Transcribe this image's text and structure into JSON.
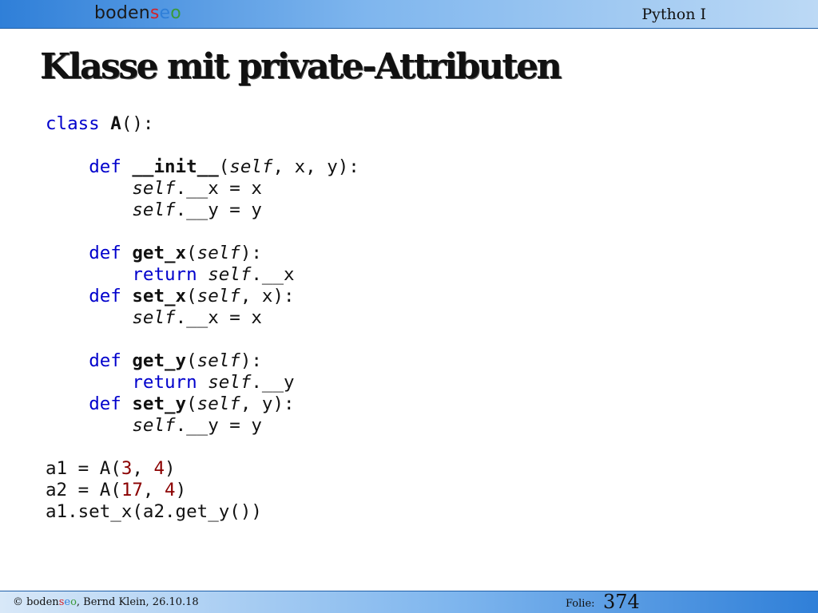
{
  "header": {
    "brand": {
      "part1": "boden",
      "part2": "s",
      "part3": "e",
      "part4": "o"
    },
    "course": "Python I"
  },
  "title": "Klasse mit private-Attributen",
  "code": {
    "tokens": {
      "class": "class",
      "A": "A",
      "paren_colon": "():",
      "def": "def",
      "init": "__init__",
      "self": "self",
      "return": "return",
      "get_x": "get_x",
      "set_x": "set_x",
      "get_y": "get_y",
      "set_y": "set_y",
      "open": "(",
      "close_colon": "):",
      "args_xy": ", x, y):",
      "arg_x": ", x):",
      "arg_y": ", y):",
      "attr_x_assign": ".__x = x",
      "attr_y_assign": ".__y = y",
      "attr_x": ".__x",
      "attr_y": ".__y"
    },
    "tail": {
      "a1_prefix": "a1 = A(",
      "a1_n1": "3",
      "comma": ", ",
      "a1_n2": "4",
      "close": ")",
      "a2_prefix": "a2 = A(",
      "a2_n1": "17",
      "a2_n2": "4",
      "last_line": "a1.set_x(a2.get_y())"
    }
  },
  "footer": {
    "copyright_prefix": "© ",
    "brand": {
      "part1": "boden",
      "part2": "s",
      "part3": "e",
      "part4": "o"
    },
    "author_date": ", Bernd Klein, 26.10.18",
    "folie_label": "Folie:",
    "folie_number": "374"
  },
  "colors": {
    "keyword": "#0000cc",
    "number": "#8b0000",
    "header_gradient_start": "#2f7fd8",
    "brand_red": "#d2232a",
    "brand_green": "#3a9a3a"
  }
}
